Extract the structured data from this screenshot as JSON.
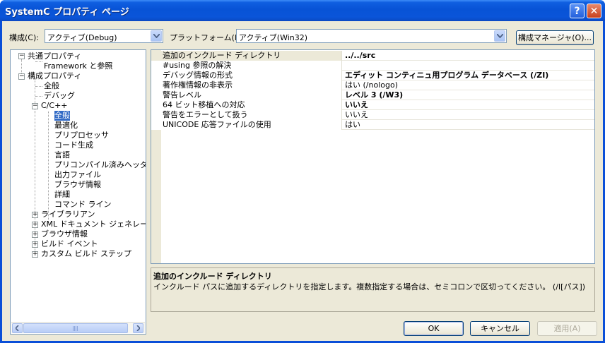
{
  "window": {
    "title": "SystemC プロパティ ページ",
    "help_label": "?",
    "close_label": "✕"
  },
  "config": {
    "label": "構成(C):",
    "value": "アクティブ(Debug)",
    "platform_label": "プラットフォーム(P):",
    "platform_value": "アクティブ(Win32)",
    "manager_label": "構成マネージャ(O)..."
  },
  "tree": {
    "common": "共通プロパティ",
    "framework": "Framework と参照",
    "config_props": "構成プロパティ",
    "general": "全般",
    "debug": "デバッグ",
    "cpp": "C/C++",
    "cpp_items": [
      "全般",
      "最適化",
      "プリプロセッサ",
      "コード生成",
      "言語",
      "プリコンパイル済みヘッダー",
      "出力ファイル",
      "ブラウザ情報",
      "詳細",
      "コマンド ライン"
    ],
    "more_items": [
      "ライブラリアン",
      "XML ドキュメント ジェネレータ",
      "ブラウザ情報",
      "ビルド イベント",
      "カスタム ビルド ステップ"
    ]
  },
  "properties": [
    {
      "name": "追加のインクルード ディレクトリ",
      "value": "../../src",
      "bold": true
    },
    {
      "name": "#using 参照の解決",
      "value": "",
      "bold": false
    },
    {
      "name": "デバッグ情報の形式",
      "value": "エディット コンティニュ用プログラム データベース (/ZI)",
      "bold": true
    },
    {
      "name": "著作権情報の非表示",
      "value": "はい (/nologo)",
      "bold": false
    },
    {
      "name": "警告レベル",
      "value": "レベル 3 (/W3)",
      "bold": true
    },
    {
      "name": "64 ビット移植への対応",
      "value": "いいえ",
      "bold": true
    },
    {
      "name": "警告をエラーとして扱う",
      "value": "いいえ",
      "bold": false
    },
    {
      "name": "UNICODE 応答ファイルの使用",
      "value": "はい",
      "bold": false
    }
  ],
  "description": {
    "title": "追加のインクルード ディレクトリ",
    "body": "インクルード パスに追加するディレクトリを指定します。複数指定する場合は、セミコロンで区切ってください。    (/I[パス])"
  },
  "buttons": {
    "ok": "OK",
    "cancel": "キャンセル",
    "apply": "適用(A)"
  },
  "colors": {
    "titlebar": "#0a55d9",
    "selection": "#316ac5",
    "face": "#ece9d8"
  }
}
